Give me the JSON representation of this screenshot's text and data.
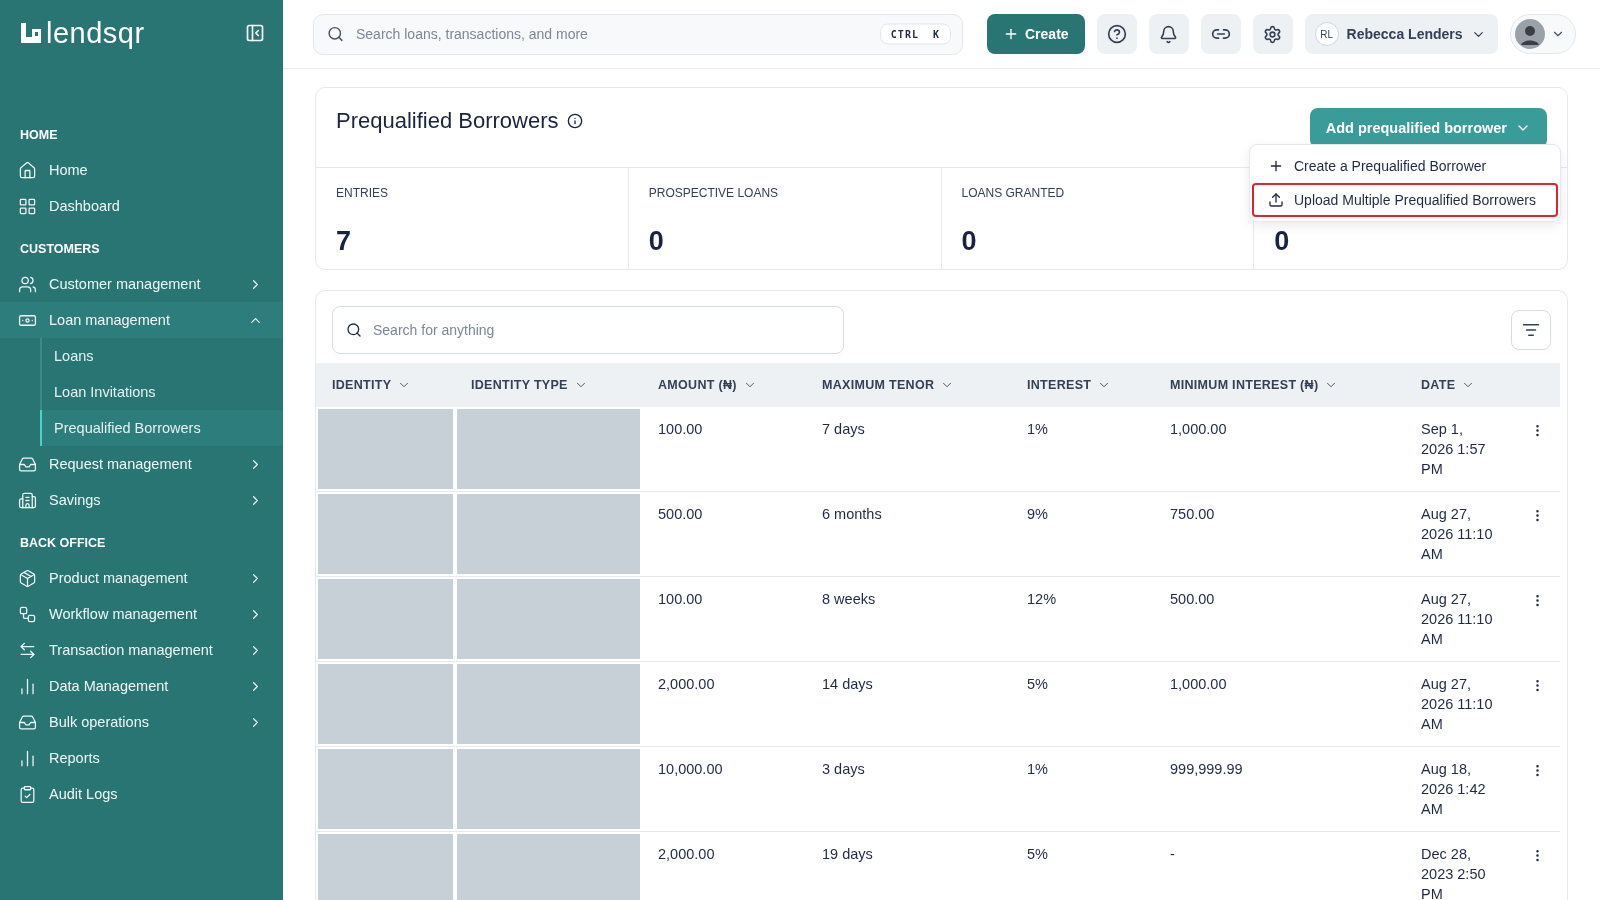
{
  "sidebar": {
    "logo": "lendsqr",
    "sections": [
      {
        "title": "HOME",
        "items": [
          {
            "label": "Home"
          },
          {
            "label": "Dashboard"
          }
        ]
      },
      {
        "title": "CUSTOMERS",
        "items": [
          {
            "label": "Customer management",
            "expanded": false
          },
          {
            "label": "Loan management",
            "expanded": true,
            "children": [
              {
                "label": "Loans",
                "selected": false
              },
              {
                "label": "Loan Invitations",
                "selected": false
              },
              {
                "label": "Prequalified Borrowers",
                "selected": true
              }
            ]
          },
          {
            "label": "Request management",
            "expanded": false
          },
          {
            "label": "Savings",
            "expanded": false
          }
        ]
      },
      {
        "title": "BACK OFFICE",
        "items": [
          {
            "label": "Product management",
            "expanded": false
          },
          {
            "label": "Workflow management",
            "expanded": false
          },
          {
            "label": "Transaction management",
            "expanded": false
          },
          {
            "label": "Data Management",
            "expanded": false
          },
          {
            "label": "Bulk operations",
            "expanded": false
          },
          {
            "label": "Reports"
          },
          {
            "label": "Audit Logs"
          }
        ]
      }
    ]
  },
  "topbar": {
    "search": {
      "placeholder": "Search loans, transactions, and more",
      "shortcut": "CTRL  K"
    },
    "create_button": "Create",
    "user": {
      "initials": "RL",
      "name": "Rebecca Lenders"
    }
  },
  "page": {
    "title": "Prequalified Borrowers",
    "add_button": "Add prequalified borrower",
    "add_menu": [
      {
        "label": "Create a Prequalified Borrower",
        "highlighted": false
      },
      {
        "label": "Upload Multiple Prequalified Borrowers",
        "highlighted": true
      }
    ],
    "stats": [
      {
        "label": "ENTRIES",
        "value": "7"
      },
      {
        "label": "PROSPECTIVE LOANS",
        "value": "0"
      },
      {
        "label": "LOANS GRANTED",
        "value": "0"
      },
      {
        "value": "0"
      }
    ]
  },
  "table": {
    "search": {
      "placeholder": "Search for anything"
    },
    "columns": [
      "IDENTITY",
      "IDENTITY TYPE",
      "AMOUNT (₦)",
      "MAXIMUM TENOR",
      "INTEREST",
      "MINIMUM INTEREST (₦)",
      "DATE"
    ],
    "rows": [
      {
        "amount": "100.00",
        "tenor": "7 days",
        "interest": "1%",
        "min_interest": "1,000.00",
        "date": "Sep 1, 2026 1:57 PM"
      },
      {
        "amount": "500.00",
        "tenor": "6 months",
        "interest": "9%",
        "min_interest": "750.00",
        "date": "Aug 27, 2026 11:10 AM"
      },
      {
        "amount": "100.00",
        "tenor": "8 weeks",
        "interest": "12%",
        "min_interest": "500.00",
        "date": "Aug 27, 2026 11:10 AM"
      },
      {
        "amount": "2,000.00",
        "tenor": "14 days",
        "interest": "5%",
        "min_interest": "1,000.00",
        "date": "Aug 27, 2026 11:10 AM"
      },
      {
        "amount": "10,000.00",
        "tenor": "3 days",
        "interest": "1%",
        "min_interest": "999,999.99",
        "date": "Aug 18, 2026 1:42 AM"
      },
      {
        "amount": "2,000.00",
        "tenor": "19 days",
        "interest": "5%",
        "min_interest": "-",
        "date": "Dec 28, 2023 2:50 PM"
      }
    ]
  }
}
